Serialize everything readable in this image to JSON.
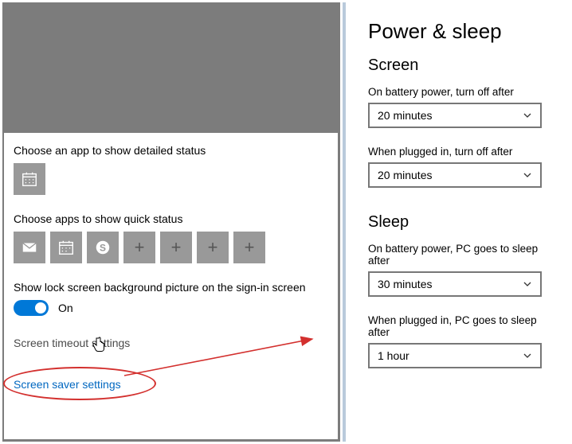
{
  "lockscreen": {
    "detailed_status_label": "Choose an app to show detailed status",
    "detailed_status_app_icon": "calendar-icon",
    "quick_status_label": "Choose apps to show quick status",
    "quick_status_apps": [
      "mail-icon",
      "calendar-icon",
      "skype-icon",
      "add-icon",
      "add-icon",
      "add-icon",
      "add-icon"
    ],
    "background_toggle_label": "Show lock screen background picture on the sign-in screen",
    "background_toggle_state": "On",
    "timeout_link": "Screen timeout settings",
    "saver_link": "Screen saver settings"
  },
  "powerpanel": {
    "title": "Power & sleep",
    "screen_heading": "Screen",
    "sleep_heading": "Sleep",
    "screen_battery_label": "On battery power, turn off after",
    "screen_battery_value": "20 minutes",
    "screen_plugged_label": "When plugged in, turn off after",
    "screen_plugged_value": "20 minutes",
    "sleep_battery_label": "On battery power, PC goes to sleep after",
    "sleep_battery_value": "30 minutes",
    "sleep_plugged_label": "When plugged in, PC goes to sleep after",
    "sleep_plugged_value": "1 hour"
  },
  "annotation": {
    "arrow_color": "#d3302e"
  }
}
